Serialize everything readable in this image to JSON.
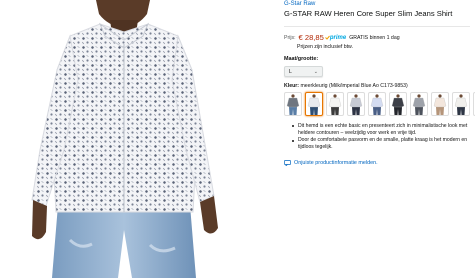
{
  "product": {
    "brand": "G-Star Raw",
    "title": "G-STAR RAW Heren Core Super Slim Jeans Shirt",
    "image_alt": "Model wearing white printed long-sleeve shirt with light blue jeans"
  },
  "price": {
    "label": "Prijs:",
    "amount": "€ 28,85",
    "prime_label": "prime",
    "shipping": "GRATIS binnen 1 dag",
    "vat_note": "Prijzen zijn inclusief btw."
  },
  "size": {
    "label": "Maat/grootte:",
    "selected": "L"
  },
  "color": {
    "label": "Kleur:",
    "value": "meerkleurig (Milk/imperial Blue Ao C173-9853)",
    "swatches": [
      {
        "shirt": "#6f7680",
        "jeans": "#5a7ea6"
      },
      {
        "shirt": "#e8eaee",
        "jeans": "#2f4f74",
        "selected": true
      },
      {
        "shirt": "#f4f4f2",
        "jeans": "#3c3c3c"
      },
      {
        "shirt": "#c7cad4",
        "jeans": "#2d3344"
      },
      {
        "shirt": "#d4dcf1",
        "jeans": "#4a5f86"
      },
      {
        "shirt": "#3d4048",
        "jeans": "#24262c"
      },
      {
        "shirt": "#9ea2aa",
        "jeans": "#4d525c"
      },
      {
        "shirt": "#f3e6dc",
        "jeans": "#b5957a"
      },
      {
        "shirt": "#f0efec",
        "jeans": "#2e3645"
      },
      {
        "shirt": "#687058",
        "jeans": "#3b3f36"
      }
    ]
  },
  "bullets": [
    "Dit hemd is een echte basic en presenteert zich in minimalistische look met heldere contouren – veelzijdig voor werk en vrije tijd.",
    "Door de comfortabele pasvorm en de smalle, platte kraag is het modern en tijdloos tegelijk."
  ],
  "report": {
    "label": "Onjuiste productinformatie melden."
  },
  "colors": {
    "link": "#0066c0",
    "price": "#b12704",
    "prime": "#00a8e1",
    "swatch_selected": "#e77600"
  }
}
